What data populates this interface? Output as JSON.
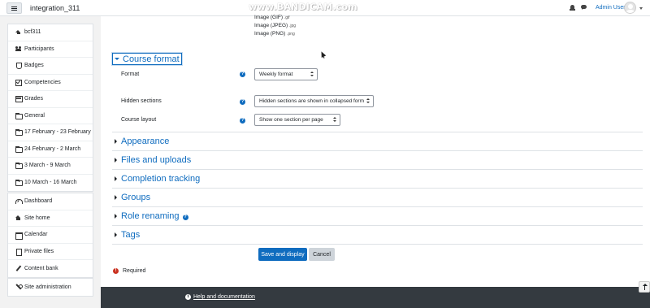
{
  "navbar": {
    "site_name": "integration_311",
    "watermark": "www.BANDICAM.com",
    "user_name": "Admin User"
  },
  "sidebar": {
    "course_items": [
      {
        "label": "bcf311",
        "icon": "graduation-cap-icon"
      },
      {
        "label": "Participants",
        "icon": "users-icon"
      },
      {
        "label": "Badges",
        "icon": "shield-icon"
      },
      {
        "label": "Competencies",
        "icon": "check-square-icon"
      },
      {
        "label": "Grades",
        "icon": "table-icon"
      },
      {
        "label": "General",
        "icon": "folder-icon"
      },
      {
        "label": "17 February - 23 February",
        "icon": "folder-icon"
      },
      {
        "label": "24 February - 2 March",
        "icon": "folder-icon"
      },
      {
        "label": "3 March - 9 March",
        "icon": "folder-icon"
      },
      {
        "label": "10 March - 16 March",
        "icon": "folder-icon"
      }
    ],
    "site_items": [
      {
        "label": "Dashboard",
        "icon": "dashboard-icon"
      },
      {
        "label": "Site home",
        "icon": "home-icon"
      },
      {
        "label": "Calendar",
        "icon": "calendar-icon"
      },
      {
        "label": "Private files",
        "icon": "file-icon"
      },
      {
        "label": "Content bank",
        "icon": "paintbrush-icon"
      }
    ],
    "admin_item": {
      "label": "Site administration",
      "icon": "wrench-icon"
    }
  },
  "file_types": [
    {
      "label": "Image (GIF)",
      "ext": ".gif"
    },
    {
      "label": "Image (JPEG)",
      "ext": ".jpg"
    },
    {
      "label": "Image (PNG)",
      "ext": ".png"
    }
  ],
  "course_format": {
    "title": "Course format",
    "format_label": "Format",
    "format_value": "Weekly format",
    "hidden_label": "Hidden sections",
    "hidden_value": "Hidden sections are shown in collapsed form",
    "layout_label": "Course layout",
    "layout_value": "Show one section per page",
    "help_glyph": "?"
  },
  "sections": [
    "Appearance",
    "Files and uploads",
    "Completion tracking",
    "Groups",
    "Role renaming",
    "Tags"
  ],
  "buttons": {
    "save": "Save and display",
    "cancel": "Cancel"
  },
  "required": {
    "glyph": "!",
    "label": "Required"
  },
  "footer": {
    "info_glyph": "i",
    "help_link": "Help and documentation"
  },
  "colors": {
    "brand": "#0f6cbf",
    "footer": "#343a40",
    "required": "#ca3120"
  }
}
